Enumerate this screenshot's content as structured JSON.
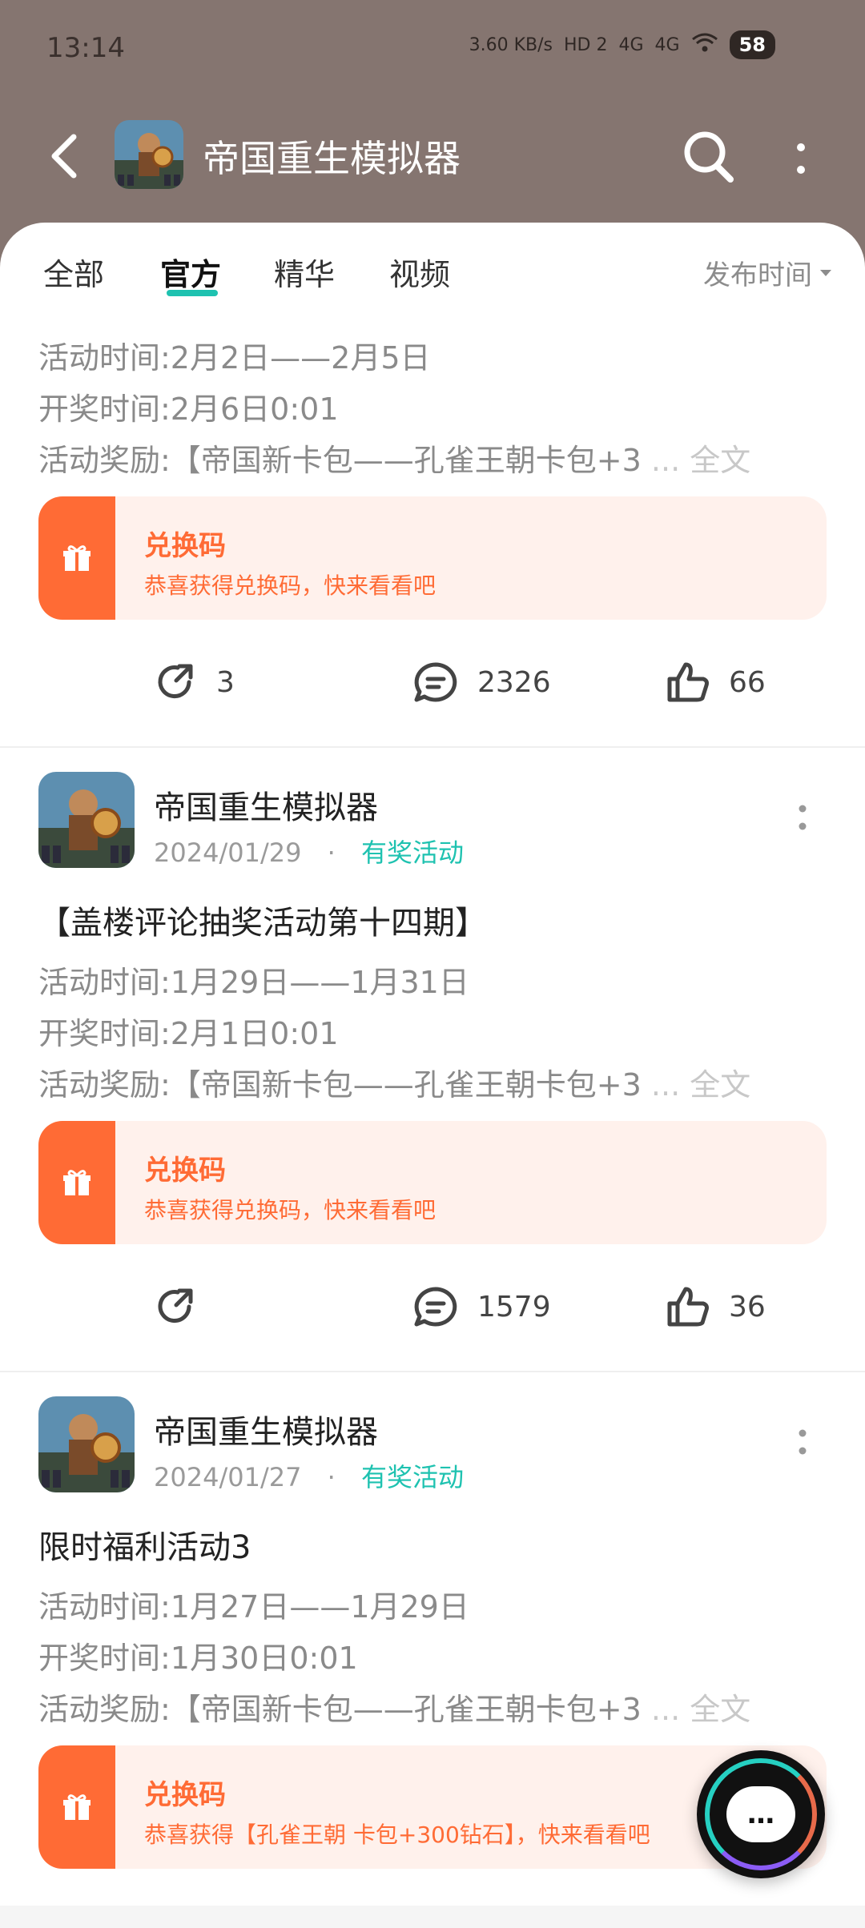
{
  "status_bar": {
    "time": "13:14",
    "net_speed": "3.60 KB/s",
    "hd": "HD 2",
    "sig1": "4G",
    "sig2": "4G",
    "battery": "58"
  },
  "header": {
    "title": "帝国重生模拟器"
  },
  "tabs": [
    {
      "label": "全部"
    },
    {
      "label": "官方"
    },
    {
      "label": "精华"
    },
    {
      "label": "视频"
    }
  ],
  "sort_label": "发布时间",
  "posts": [
    {
      "line1": "活动时间:2月2日——2月5日",
      "line2": "开奖时间:2月6日0:01",
      "line3": "活动奖励:【帝国新卡包——孔雀王朝卡包+3",
      "fulltext": "... 全文",
      "coupon_title": "兑换码",
      "coupon_desc": "恭喜获得兑换码，快来看看吧",
      "shares": "3",
      "comments": "2326",
      "likes": "66"
    },
    {
      "author": "帝国重生模拟器",
      "date": "2024/01/29",
      "dot": "·",
      "tag": "有奖活动",
      "title": "【盖楼评论抽奖活动第十四期】",
      "line1": "活动时间:1月29日——1月31日",
      "line2": "开奖时间:2月1日0:01",
      "line3": "活动奖励:【帝国新卡包——孔雀王朝卡包+3",
      "fulltext": "... 全文",
      "coupon_title": "兑换码",
      "coupon_desc": "恭喜获得兑换码，快来看看吧",
      "shares": "",
      "comments": "1579",
      "likes": "36"
    },
    {
      "author": "帝国重生模拟器",
      "date": "2024/01/27",
      "dot": "·",
      "tag": "有奖活动",
      "title": "限时福利活动3",
      "line1": "活动时间:1月27日——1月29日",
      "line2": "开奖时间:1月30日0:01",
      "line3": "活动奖励:【帝国新卡包——孔雀王朝卡包+3",
      "fulltext": "... 全文",
      "coupon_title": "兑换码",
      "coupon_desc": "恭喜获得【孔雀王朝 卡包+300钻石】，快来看看吧"
    }
  ],
  "fab_label": "…"
}
